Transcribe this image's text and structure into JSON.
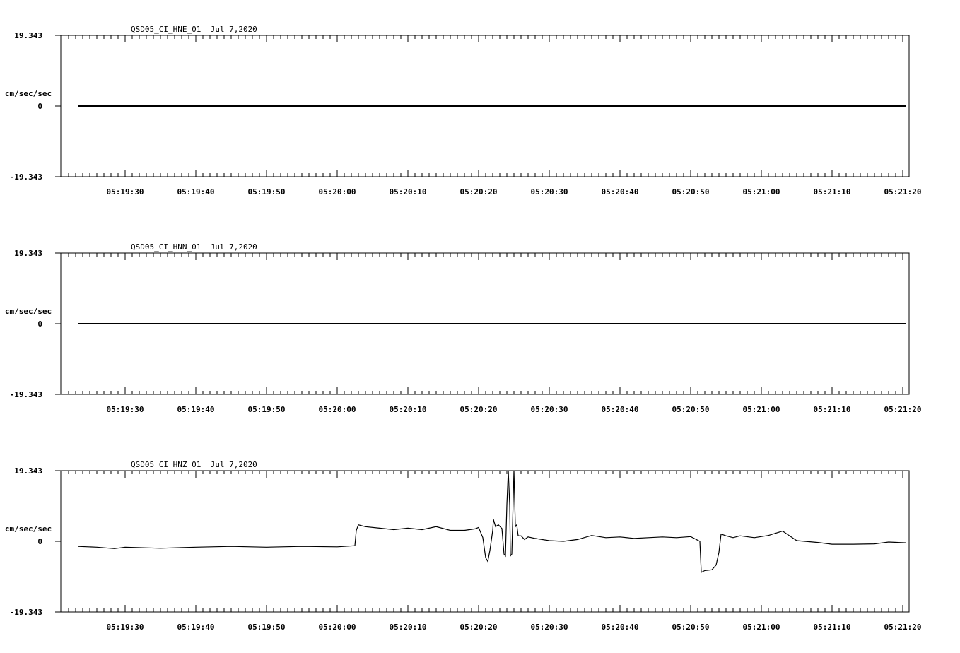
{
  "chart_data": [
    {
      "type": "line",
      "title": "QSD05_CI_HNE_01  Jul 7,2020",
      "ylabel": "cm/sec/sec",
      "ylim": [
        -19.343,
        19.343
      ],
      "yticks": [
        "19.343",
        "0",
        "-19.343"
      ],
      "xticks": [
        "05:19:30",
        "05:19:40",
        "05:19:50",
        "05:20:00",
        "05:20:10",
        "05:20:20",
        "05:20:30",
        "05:20:40",
        "05:20:50",
        "05:21:00",
        "05:21:10",
        "05:21:20"
      ],
      "xlim_seconds": [
        19161.5,
        19280.5
      ],
      "series": [
        {
          "x": [
            19163.3,
            19280.5
          ],
          "y": [
            0,
            0
          ]
        }
      ]
    },
    {
      "type": "line",
      "title": "QSD05_CI_HNN_01  Jul 7,2020",
      "ylabel": "cm/sec/sec",
      "ylim": [
        -19.343,
        19.343
      ],
      "yticks": [
        "19.343",
        "0",
        "-19.343"
      ],
      "xticks": [
        "05:19:30",
        "05:19:40",
        "05:19:50",
        "05:20:00",
        "05:20:10",
        "05:20:20",
        "05:20:30",
        "05:20:40",
        "05:20:50",
        "05:21:00",
        "05:21:10",
        "05:21:20"
      ],
      "xlim_seconds": [
        19161.5,
        19280.5
      ],
      "series": [
        {
          "x": [
            19163.3,
            19280.5
          ],
          "y": [
            0,
            0
          ]
        }
      ]
    },
    {
      "type": "line",
      "title": "QSD05_CI_HNZ_01  Jul 7,2020",
      "ylabel": "cm/sec/sec",
      "ylim": [
        -19.343,
        19.343
      ],
      "yticks": [
        "19.343",
        "0",
        "-19.343"
      ],
      "xticks": [
        "05:19:30",
        "05:19:40",
        "05:19:50",
        "05:20:00",
        "05:20:10",
        "05:20:20",
        "05:20:30",
        "05:20:40",
        "05:20:50",
        "05:21:00",
        "05:21:10",
        "05:21:20"
      ],
      "xlim_seconds": [
        19161.5,
        19280.5
      ],
      "series": [
        {
          "x": [
            19163.3,
            19166,
            19168.5,
            19170,
            19175,
            19180,
            19185,
            19190,
            19195,
            19200,
            19202.5,
            19202.7,
            19203,
            19204,
            19206,
            19208,
            19210,
            19212,
            19214,
            19216,
            19218,
            19219.5,
            19220,
            19220.6,
            19221,
            19221.3,
            19221.6,
            19222,
            19222.1,
            19222.4,
            19222.8,
            19223.3,
            19223.6,
            19223.8,
            19224,
            19224.2,
            19224.4,
            19224.5,
            19224.7,
            19225,
            19225.2,
            19225.4,
            19225.6,
            19226,
            19226.5,
            19227,
            19228,
            19230,
            19232,
            19234,
            19236,
            19238,
            19240,
            19242,
            19244,
            19246,
            19248,
            19250,
            19251.3,
            19251.5,
            19252,
            19253,
            19253.6,
            19254,
            19254.3,
            19255,
            19256,
            19257,
            19259,
            19261,
            19263,
            19265,
            19268,
            19270,
            19273,
            19276,
            19278,
            19280.5
          ],
          "y": [
            -1.4,
            -1.6,
            -2.0,
            -1.6,
            -1.9,
            -1.6,
            -1.4,
            -1.6,
            -1.4,
            -1.5,
            -1.2,
            3.0,
            4.5,
            4.0,
            3.6,
            3.2,
            3.6,
            3.2,
            4.0,
            3.0,
            3.0,
            3.4,
            3.8,
            1.0,
            -4.5,
            -5.5,
            -2.5,
            3.0,
            6.0,
            4.0,
            4.5,
            3.5,
            -3.5,
            -4.0,
            10.0,
            19.343,
            10.0,
            -4.0,
            -3.5,
            19.343,
            4.0,
            4.5,
            1.5,
            1.5,
            0.5,
            1.2,
            0.8,
            0.2,
            0,
            0.5,
            1.6,
            1.0,
            1.2,
            0.8,
            1.0,
            1.2,
            1.0,
            1.3,
            0,
            -8.5,
            -8.0,
            -7.8,
            -6.5,
            -3.0,
            2.0,
            1.5,
            1.0,
            1.5,
            1.0,
            1.6,
            2.8,
            0.2,
            -0.3,
            -0.8,
            -0.8,
            -0.7,
            -0.2,
            -0.4
          ]
        }
      ]
    }
  ]
}
